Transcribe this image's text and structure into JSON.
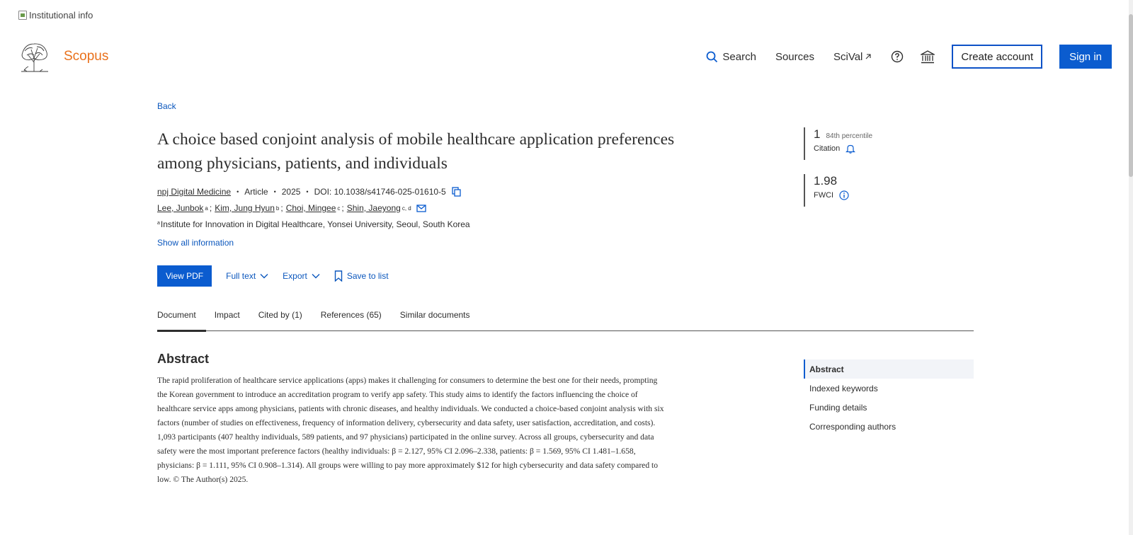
{
  "institutional": {
    "alt_text": "Institutional info"
  },
  "brand": {
    "name": "Scopus",
    "color": "#e9711c"
  },
  "topnav": {
    "search_label": "Search",
    "sources_label": "Sources",
    "scival_label": "SciVal",
    "create_account_label": "Create account",
    "sign_in_label": "Sign in",
    "accent": "#0b5ccf"
  },
  "article": {
    "back_label": "Back",
    "title": "A choice based conjoint analysis of mobile healthcare application preferences among physicians, patients, and individuals",
    "journal": "npj Digital Medicine",
    "doc_type": "Article",
    "year": "2025",
    "doi": "DOI: 10.1038/s41746-025-01610-5",
    "authors": [
      {
        "name": "Lee, Junbok",
        "sup": "a"
      },
      {
        "name": "Kim, Jung Hyun",
        "sup": "b"
      },
      {
        "name": "Choi, Mingee",
        "sup": "c"
      },
      {
        "name": "Shin, Jaeyong",
        "sup": "c, d"
      }
    ],
    "affiliation_sup": "a",
    "affiliation": "Institute for Innovation in Digital Healthcare, Yonsei University, Seoul, South Korea",
    "show_all_label": "Show all information"
  },
  "actions": {
    "view_pdf": "View PDF",
    "full_text": "Full text",
    "export": "Export",
    "save_to_list": "Save to list"
  },
  "tabs": [
    {
      "label": "Document",
      "active": true
    },
    {
      "label": "Impact",
      "active": false
    },
    {
      "label": "Cited by (1)",
      "active": false
    },
    {
      "label": "References (65)",
      "active": false
    },
    {
      "label": "Similar documents",
      "active": false
    }
  ],
  "metrics": {
    "citations": {
      "value": "1",
      "percentile": "84th percentile",
      "label": "Citation"
    },
    "fwci": {
      "value": "1.98",
      "label": "FWCI"
    }
  },
  "abstract": {
    "heading": "Abstract",
    "body": "The rapid proliferation of healthcare service applications (apps) makes it challenging for consumers to determine the best one for their needs, prompting the Korean government to introduce an accreditation program to verify app safety. This study aims to identify the factors influencing the choice of healthcare service apps among physicians, patients with chronic diseases, and healthy individuals. We conducted a choice-based conjoint analysis with six factors (number of studies on effectiveness, frequency of information delivery, cybersecurity and data safety, user satisfaction, accreditation, and costs). 1,093 participants (407 healthy individuals, 589 patients, and 97 physicians) participated in the online survey. Across all groups, cybersecurity and data safety were the most important preference factors (healthy individuals: β = 2.127, 95% CI 2.096–2.338, patients: β = 1.569, 95% CI 1.481–1.658, physicians: β = 1.111, 95% CI 0.908–1.314). All groups were willing to pay more approximately $12 for high cybersecurity and data safety compared to low. © The Author(s) 2025."
  },
  "toc": [
    {
      "label": "Abstract",
      "active": true
    },
    {
      "label": "Indexed keywords",
      "active": false
    },
    {
      "label": "Funding details",
      "active": false
    },
    {
      "label": "Corresponding authors",
      "active": false
    }
  ]
}
